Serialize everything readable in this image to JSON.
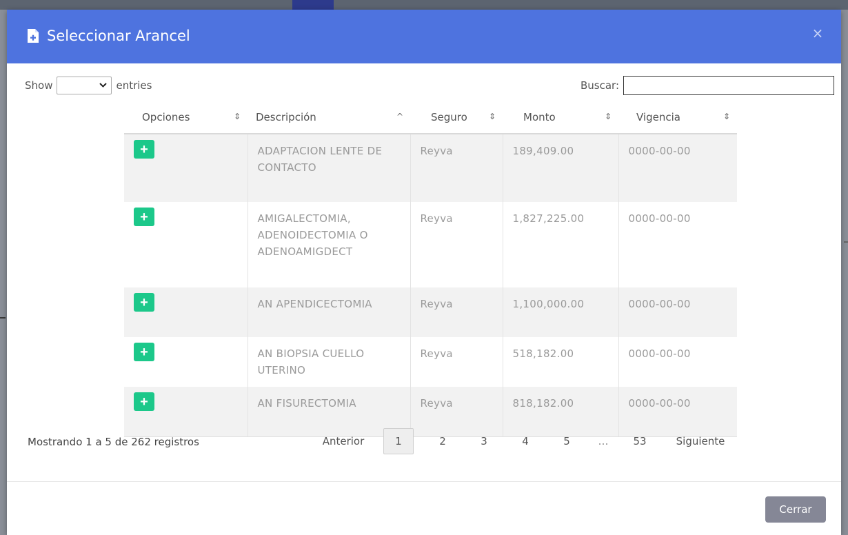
{
  "modal": {
    "title": "Seleccionar Arancel",
    "title_icon": "file-plus-icon",
    "close_symbol": "×",
    "close_icon": "close-icon",
    "header_color": "#4e73df"
  },
  "controls": {
    "show_label": "Show",
    "length_value": "",
    "entries_label": "entries",
    "search_label": "Buscar:",
    "search_value": ""
  },
  "table": {
    "columns": [
      "Opciones",
      "Descripción",
      "Seguro",
      "Monto",
      "Vigencia"
    ],
    "sort_icons": [
      "⇕",
      "^",
      "⇕",
      "⇕",
      "⇕"
    ],
    "add_label": "+",
    "add_color": "#1cc88a",
    "rows": [
      {
        "descripcion": "ADAPTACION LENTE DE CONTACTO",
        "seguro": "Reyva",
        "monto": "189,409.00",
        "vigencia": "0000-00-00"
      },
      {
        "descripcion": "AMIGALECTOMIA, ADENOIDECTOMIA O ADENOAMIGDECT",
        "seguro": "Reyva",
        "monto": "1,827,225.00",
        "vigencia": "0000-00-00"
      },
      {
        "descripcion": "AN APENDICECTOMIA",
        "seguro": "Reyva",
        "monto": "1,100,000.00",
        "vigencia": "0000-00-00"
      },
      {
        "descripcion": "AN BIOPSIA CUELLO UTERINO",
        "seguro": "Reyva",
        "monto": "518,182.00",
        "vigencia": "0000-00-00"
      },
      {
        "descripcion": "AN FISURECTOMIA",
        "seguro": "Reyva",
        "monto": "818,182.00",
        "vigencia": "0000-00-00"
      }
    ]
  },
  "pagination": {
    "info": "Mostrando 1 a 5 de 262 registros",
    "prev": "Anterior",
    "pages": [
      "1",
      "2",
      "3",
      "4",
      "5"
    ],
    "ellipsis": "…",
    "last": "53",
    "next": "Siguiente",
    "current": "1"
  },
  "footer": {
    "close_label": "Cerrar",
    "close_color": "#858796"
  }
}
